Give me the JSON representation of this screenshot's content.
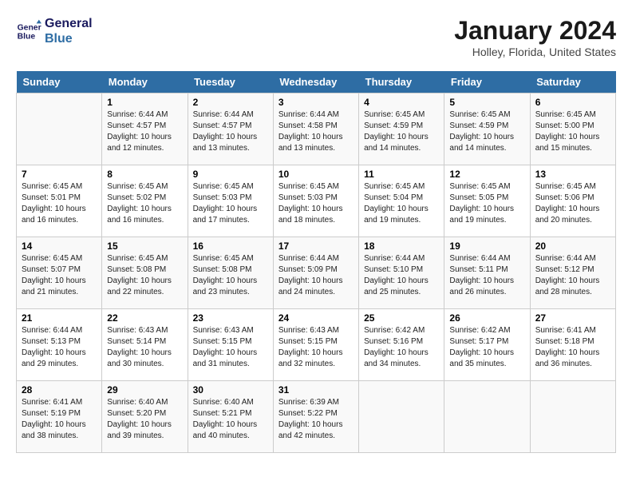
{
  "header": {
    "logo_line1": "General",
    "logo_line2": "Blue",
    "month_year": "January 2024",
    "location": "Holley, Florida, United States"
  },
  "weekdays": [
    "Sunday",
    "Monday",
    "Tuesday",
    "Wednesday",
    "Thursday",
    "Friday",
    "Saturday"
  ],
  "weeks": [
    [
      {
        "day": "",
        "sunrise": "",
        "sunset": "",
        "daylight": ""
      },
      {
        "day": "1",
        "sunrise": "6:44 AM",
        "sunset": "4:57 PM",
        "daylight": "10 hours and 12 minutes."
      },
      {
        "day": "2",
        "sunrise": "6:44 AM",
        "sunset": "4:57 PM",
        "daylight": "10 hours and 13 minutes."
      },
      {
        "day": "3",
        "sunrise": "6:44 AM",
        "sunset": "4:58 PM",
        "daylight": "10 hours and 13 minutes."
      },
      {
        "day": "4",
        "sunrise": "6:45 AM",
        "sunset": "4:59 PM",
        "daylight": "10 hours and 14 minutes."
      },
      {
        "day": "5",
        "sunrise": "6:45 AM",
        "sunset": "4:59 PM",
        "daylight": "10 hours and 14 minutes."
      },
      {
        "day": "6",
        "sunrise": "6:45 AM",
        "sunset": "5:00 PM",
        "daylight": "10 hours and 15 minutes."
      }
    ],
    [
      {
        "day": "7",
        "sunrise": "6:45 AM",
        "sunset": "5:01 PM",
        "daylight": "10 hours and 16 minutes."
      },
      {
        "day": "8",
        "sunrise": "6:45 AM",
        "sunset": "5:02 PM",
        "daylight": "10 hours and 16 minutes."
      },
      {
        "day": "9",
        "sunrise": "6:45 AM",
        "sunset": "5:03 PM",
        "daylight": "10 hours and 17 minutes."
      },
      {
        "day": "10",
        "sunrise": "6:45 AM",
        "sunset": "5:03 PM",
        "daylight": "10 hours and 18 minutes."
      },
      {
        "day": "11",
        "sunrise": "6:45 AM",
        "sunset": "5:04 PM",
        "daylight": "10 hours and 19 minutes."
      },
      {
        "day": "12",
        "sunrise": "6:45 AM",
        "sunset": "5:05 PM",
        "daylight": "10 hours and 19 minutes."
      },
      {
        "day": "13",
        "sunrise": "6:45 AM",
        "sunset": "5:06 PM",
        "daylight": "10 hours and 20 minutes."
      }
    ],
    [
      {
        "day": "14",
        "sunrise": "6:45 AM",
        "sunset": "5:07 PM",
        "daylight": "10 hours and 21 minutes."
      },
      {
        "day": "15",
        "sunrise": "6:45 AM",
        "sunset": "5:08 PM",
        "daylight": "10 hours and 22 minutes."
      },
      {
        "day": "16",
        "sunrise": "6:45 AM",
        "sunset": "5:08 PM",
        "daylight": "10 hours and 23 minutes."
      },
      {
        "day": "17",
        "sunrise": "6:44 AM",
        "sunset": "5:09 PM",
        "daylight": "10 hours and 24 minutes."
      },
      {
        "day": "18",
        "sunrise": "6:44 AM",
        "sunset": "5:10 PM",
        "daylight": "10 hours and 25 minutes."
      },
      {
        "day": "19",
        "sunrise": "6:44 AM",
        "sunset": "5:11 PM",
        "daylight": "10 hours and 26 minutes."
      },
      {
        "day": "20",
        "sunrise": "6:44 AM",
        "sunset": "5:12 PM",
        "daylight": "10 hours and 28 minutes."
      }
    ],
    [
      {
        "day": "21",
        "sunrise": "6:44 AM",
        "sunset": "5:13 PM",
        "daylight": "10 hours and 29 minutes."
      },
      {
        "day": "22",
        "sunrise": "6:43 AM",
        "sunset": "5:14 PM",
        "daylight": "10 hours and 30 minutes."
      },
      {
        "day": "23",
        "sunrise": "6:43 AM",
        "sunset": "5:15 PM",
        "daylight": "10 hours and 31 minutes."
      },
      {
        "day": "24",
        "sunrise": "6:43 AM",
        "sunset": "5:15 PM",
        "daylight": "10 hours and 32 minutes."
      },
      {
        "day": "25",
        "sunrise": "6:42 AM",
        "sunset": "5:16 PM",
        "daylight": "10 hours and 34 minutes."
      },
      {
        "day": "26",
        "sunrise": "6:42 AM",
        "sunset": "5:17 PM",
        "daylight": "10 hours and 35 minutes."
      },
      {
        "day": "27",
        "sunrise": "6:41 AM",
        "sunset": "5:18 PM",
        "daylight": "10 hours and 36 minutes."
      }
    ],
    [
      {
        "day": "28",
        "sunrise": "6:41 AM",
        "sunset": "5:19 PM",
        "daylight": "10 hours and 38 minutes."
      },
      {
        "day": "29",
        "sunrise": "6:40 AM",
        "sunset": "5:20 PM",
        "daylight": "10 hours and 39 minutes."
      },
      {
        "day": "30",
        "sunrise": "6:40 AM",
        "sunset": "5:21 PM",
        "daylight": "10 hours and 40 minutes."
      },
      {
        "day": "31",
        "sunrise": "6:39 AM",
        "sunset": "5:22 PM",
        "daylight": "10 hours and 42 minutes."
      },
      {
        "day": "",
        "sunrise": "",
        "sunset": "",
        "daylight": ""
      },
      {
        "day": "",
        "sunrise": "",
        "sunset": "",
        "daylight": ""
      },
      {
        "day": "",
        "sunrise": "",
        "sunset": "",
        "daylight": ""
      }
    ]
  ]
}
